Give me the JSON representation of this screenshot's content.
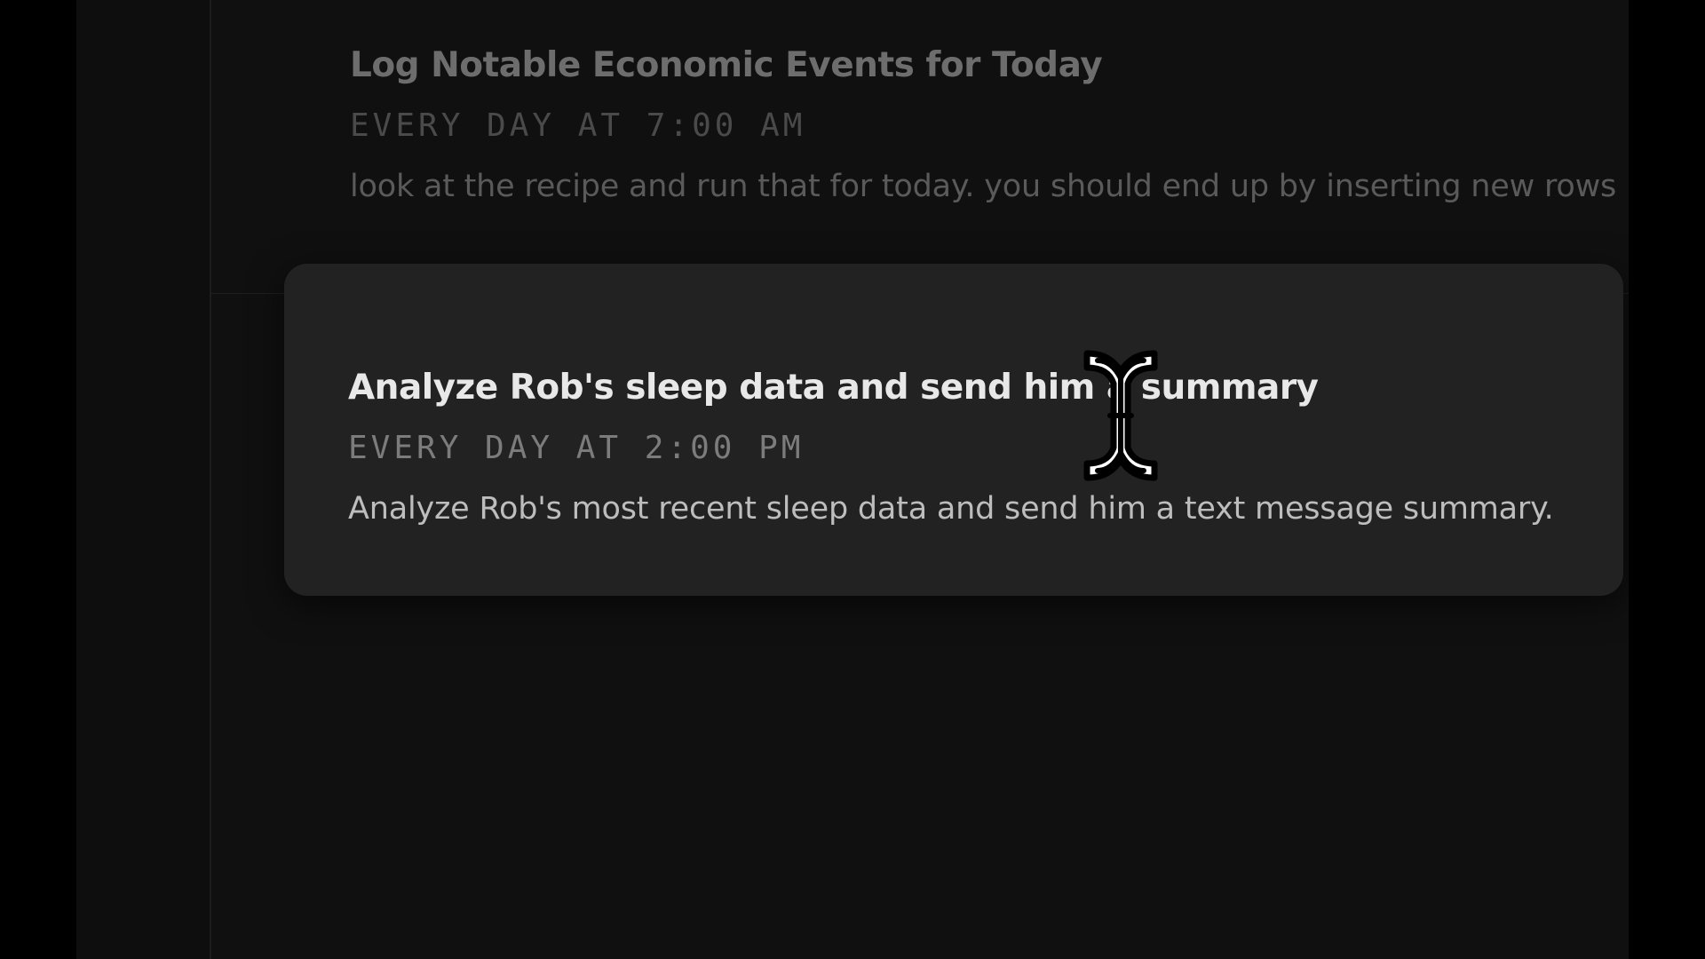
{
  "tasks": [
    {
      "title": "Log Notable Economic Events for Today",
      "schedule": "EVERY DAY AT 7:00 AM",
      "description": "look at the recipe and run that for today. you should end up by inserting new rows into"
    },
    {
      "title": "Analyze Rob's sleep data and send him a summary",
      "schedule": "EVERY DAY AT 2:00 PM",
      "description": "Analyze Rob's most recent sleep data and send him a text message summary."
    }
  ],
  "cursor": {
    "icon": "text-cursor-icon"
  },
  "colors": {
    "background": "#000000",
    "panel": "#101010",
    "card": "#222222",
    "title_active": "#e8e8e8",
    "title_dim": "#6d6d6d"
  }
}
